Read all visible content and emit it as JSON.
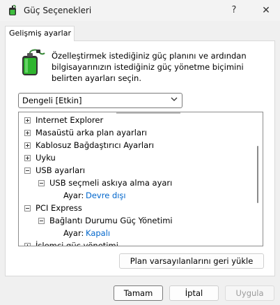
{
  "window": {
    "title": "Güç Seçenekleri",
    "help_glyph": "?",
    "close_glyph": "✕"
  },
  "tab": {
    "label": "Gelişmiş ayarlar"
  },
  "description": "Özelleştirmek istediğiniz güç planını ve ardından bilgisayarınızın istediğiniz güç yönetme biçimini belirten ayarları seçin.",
  "plan_select": {
    "value": "Dengeli [Etkin]"
  },
  "tree": {
    "items": [
      {
        "label": "Internet Explorer",
        "level": 0,
        "expanded": false
      },
      {
        "label": "Masaüstü arka plan ayarları",
        "level": 0,
        "expanded": false
      },
      {
        "label": "Kablosuz Bağdaştırıcı Ayarları",
        "level": 0,
        "expanded": false
      },
      {
        "label": "Uyku",
        "level": 0,
        "expanded": false
      },
      {
        "label": "USB ayarları",
        "level": 0,
        "expanded": true
      },
      {
        "label": "USB seçmeli askıya alma ayarı",
        "level": 1,
        "expanded": true
      },
      {
        "label": "Ayar:",
        "value": "Devre dışı",
        "level": 2
      },
      {
        "label": "PCI Express",
        "level": 0,
        "expanded": true
      },
      {
        "label": "Bağlantı Durumu Güç Yönetimi",
        "level": 1,
        "expanded": true
      },
      {
        "label": "Ayar:",
        "value": "Kapalı",
        "level": 2
      },
      {
        "label": "İşlemci güç yönetimi",
        "level": 0,
        "expanded": false
      }
    ]
  },
  "buttons": {
    "restore_defaults": "Plan varsayılanlarını geri yükle",
    "ok": "Tamam",
    "cancel": "İptal",
    "apply": "Uygula"
  },
  "colors": {
    "link_value": "#0066cc",
    "window_bg": "#f0f0f0"
  }
}
